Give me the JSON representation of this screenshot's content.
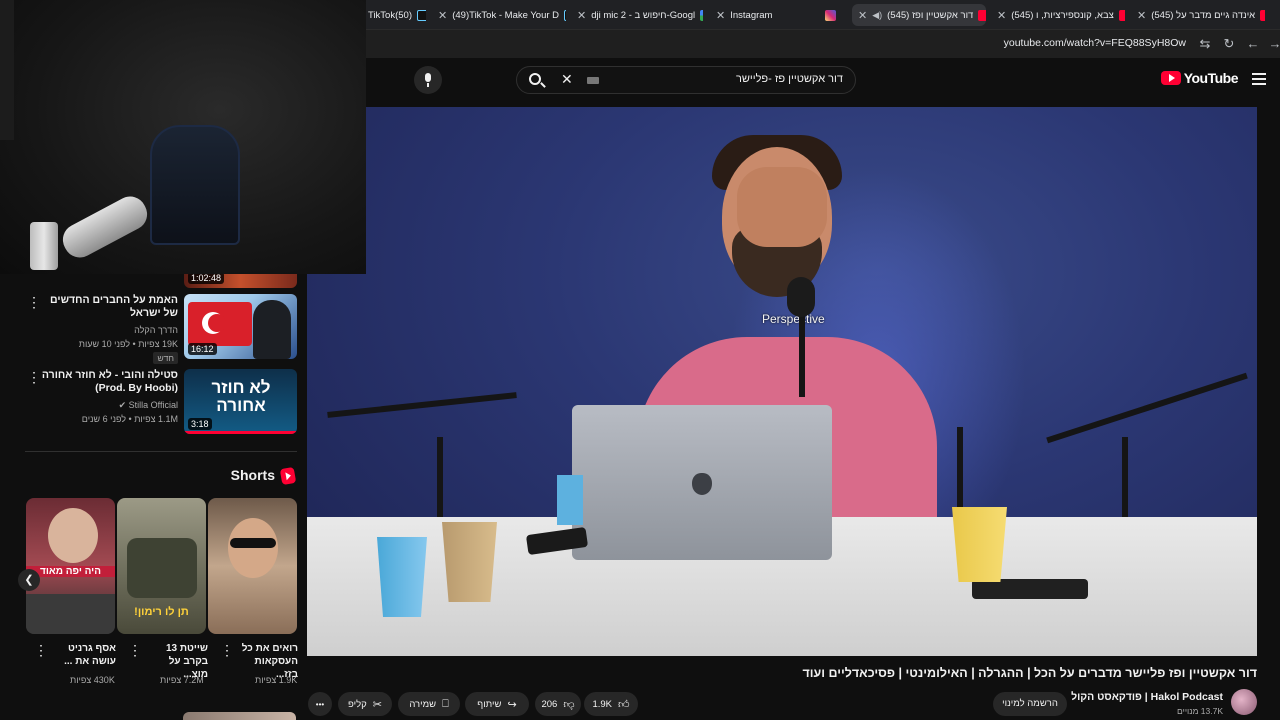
{
  "browser": {
    "tabs": [
      {
        "label": "TikTok(50)",
        "favicon": "tiktok-icon"
      },
      {
        "label": "(49)TikTok - Make Your D",
        "favicon": "tiktok-icon"
      },
      {
        "label": "dji mic 2 - חיפוש ב-Googl",
        "favicon": "google-icon"
      },
      {
        "label": "Instagram",
        "favicon": "instagram-icon"
      },
      {
        "label": "(545) דור אקשטיין ופז",
        "favicon": "youtube-icon",
        "active": true
      },
      {
        "label": "(545) צבא, קונספירציות, ו",
        "favicon": "youtube-icon"
      },
      {
        "label": "(545) אינדה גיים מדבר על",
        "favicon": "youtube-icon"
      }
    ],
    "url": "youtube.com/watch?v=FEQ88SyH8Ow"
  },
  "youtube": {
    "logo_text": "YouTube",
    "search_query": "דור אקשטיין פז -פליישר"
  },
  "video": {
    "overlay_text": "Perspective",
    "title": "דור אקשטיין ופז פליישר מדברים על הכל | ההגרלה | האילומינטי | פסיכאדליים ועוד",
    "channel_name": "Hakol Podcast | פודקאסט הקול",
    "channel_subs": "13.7K מנויים",
    "subscribe_label": "הרשמה למינוי",
    "likes": "1.9K",
    "dislikes_count": "206",
    "share_label": "שיתוף",
    "save_label": "שמירה",
    "clip_label": "קליפ",
    "more_label": "•••"
  },
  "sidebar": {
    "items": [
      {
        "title": "",
        "duration": "1:02:48"
      },
      {
        "title": "האמת על החברים החדשים של ישראל",
        "channel": "הדרך הקלה",
        "stats": "19K צפיות • לפני 10 שעות",
        "badge": "חדש",
        "duration": "16:12"
      },
      {
        "title": "סטילה והובי - לא חוזר אחורה (Prod. By Hoobi)",
        "channel": "Stilla Official",
        "stats": "1.1M צפיות • לפני 6 שנים",
        "duration": "3:18",
        "thumb_text": "לא חוזר אחורה"
      }
    ],
    "shorts_title": "Shorts",
    "shorts": [
      {
        "caption": "רואים את כל העסקאות בזז...",
        "views": "1.9K צפיות"
      },
      {
        "caption": "שייטת 13 בקרב על מוצ...",
        "views": "7.2M צפיות",
        "thumb_text": "תן לו רימון!"
      },
      {
        "caption": "אסף גרניט עושה את ...",
        "views": "430K צפיות",
        "thumb_text": "היה יפה מאוד"
      }
    ]
  },
  "colors": {
    "youtube_red": "#ff0033",
    "background": "#0f0f0f",
    "chip": "#272727"
  }
}
